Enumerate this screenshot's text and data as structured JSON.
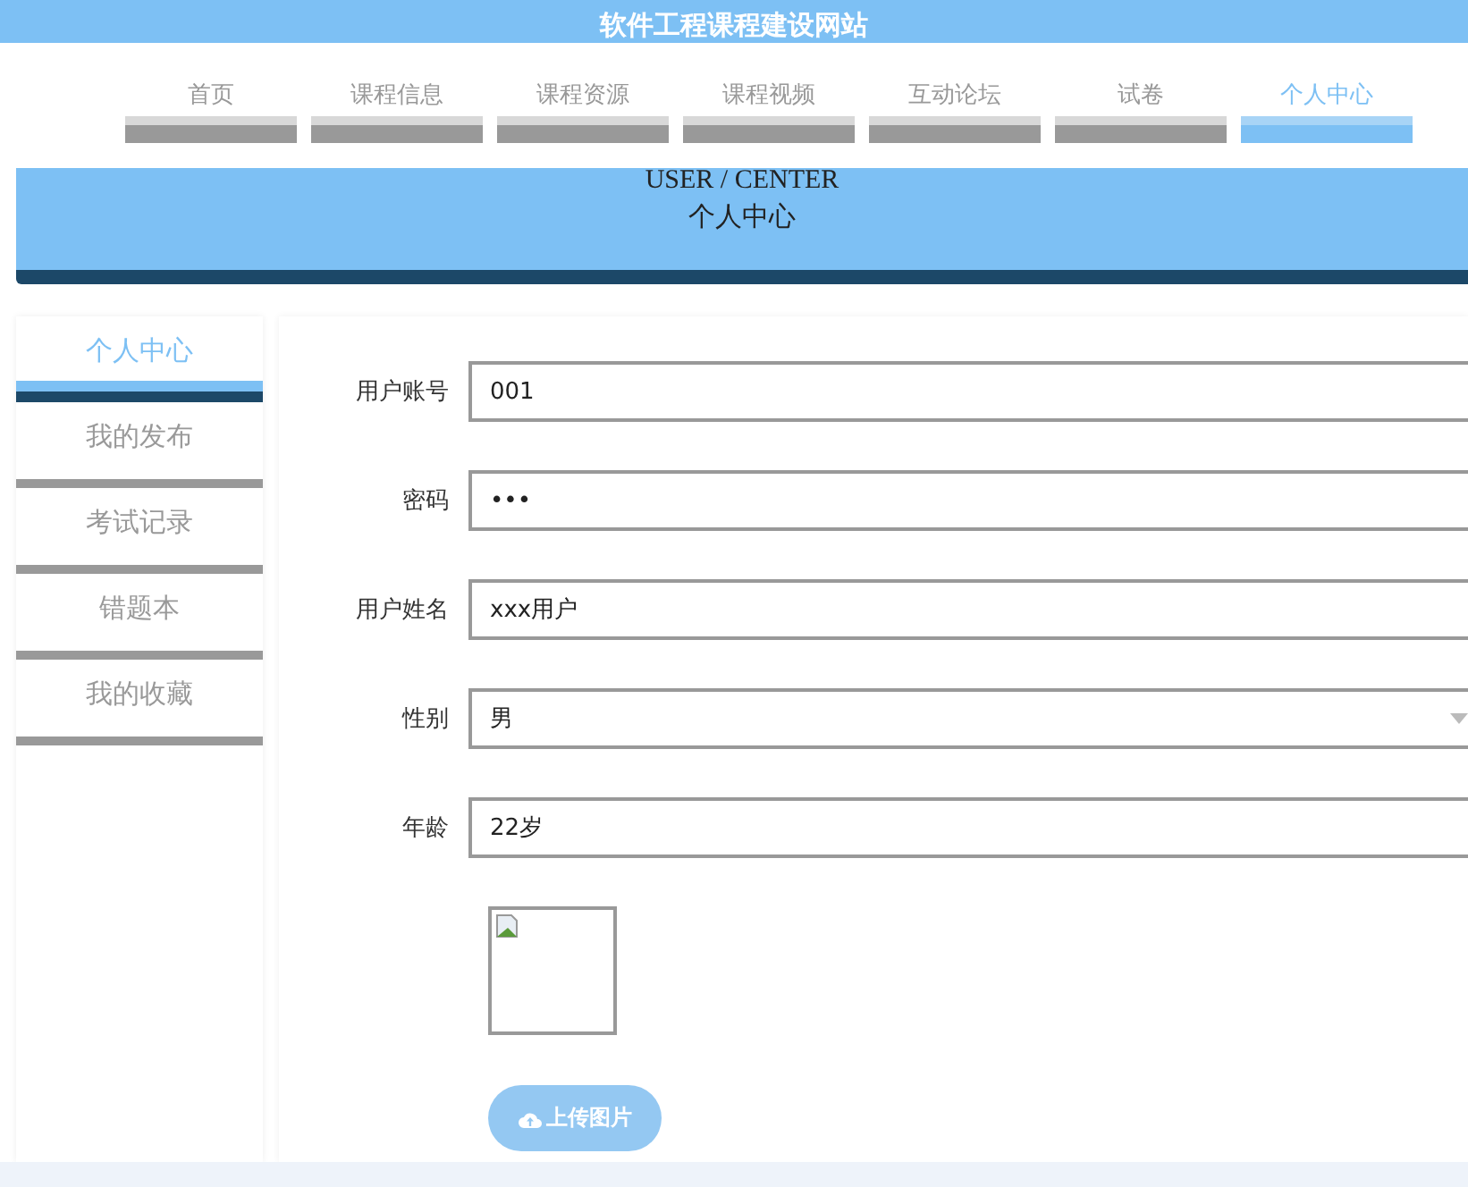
{
  "site_title": "软件工程课程建设网站",
  "nav": [
    {
      "label": "首页",
      "selected": false
    },
    {
      "label": "课程信息",
      "selected": false
    },
    {
      "label": "课程资源",
      "selected": false
    },
    {
      "label": "课程视频",
      "selected": false
    },
    {
      "label": "互动论坛",
      "selected": false
    },
    {
      "label": "试卷",
      "selected": false
    },
    {
      "label": "个人中心",
      "selected": true
    }
  ],
  "banner": {
    "subtitle": "USER / CENTER",
    "title": "个人中心"
  },
  "sidebar": [
    {
      "label": "个人中心",
      "selected": true
    },
    {
      "label": "我的发布",
      "selected": false
    },
    {
      "label": "考试记录",
      "selected": false
    },
    {
      "label": "错题本",
      "selected": false
    },
    {
      "label": "我的收藏",
      "selected": false
    }
  ],
  "form": [
    {
      "kind": "text",
      "label": "用户账号",
      "value": "001"
    },
    {
      "kind": "password",
      "label": "密码",
      "value": "•••"
    },
    {
      "kind": "text",
      "label": "用户姓名",
      "value": "xxx用户"
    },
    {
      "kind": "select",
      "label": "性别",
      "value": "男"
    },
    {
      "kind": "text",
      "label": "年龄",
      "value": "22岁"
    }
  ],
  "upload_button": "上传图片"
}
